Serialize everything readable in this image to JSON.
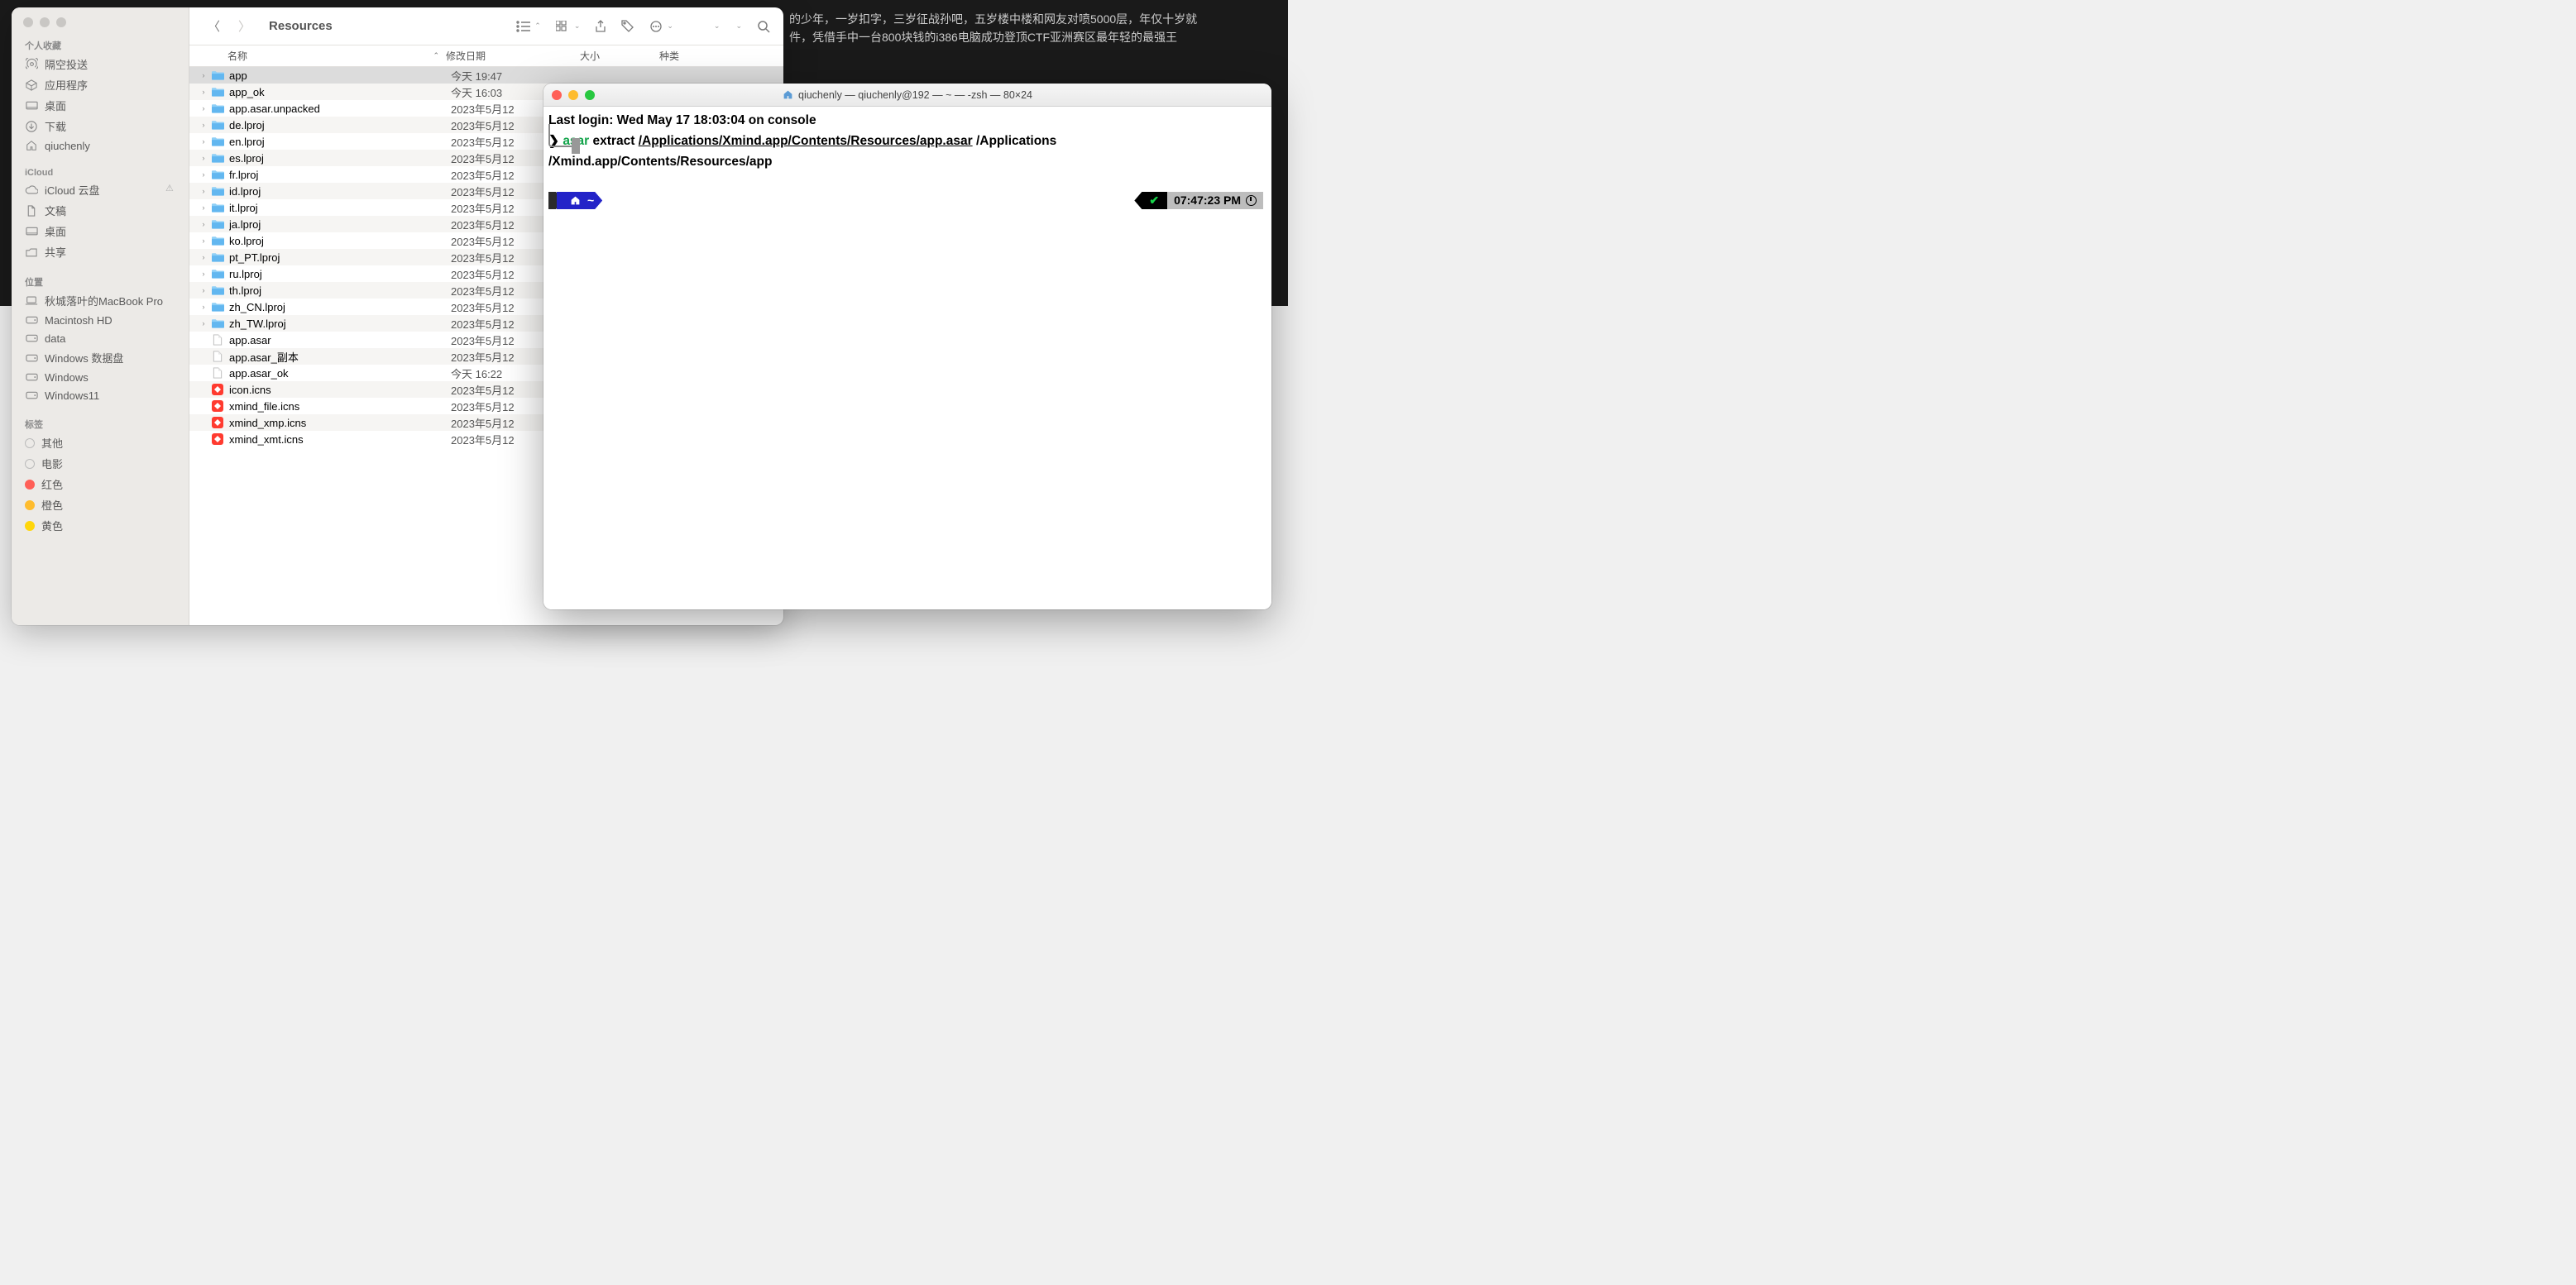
{
  "background_text": {
    "line1": "的少年，一岁扣字，三岁征战孙吧，五岁楼中楼和网友对喷5000层，年仅十岁就",
    "line2": "件，凭借手中一台800块钱的i386电脑成功登顶CTF亚洲赛区最年轻的最强王"
  },
  "finder": {
    "title": "Resources",
    "sidebar": {
      "favorites_label": "个人收藏",
      "favorites": [
        {
          "icon": "airdrop",
          "label": "隔空投送"
        },
        {
          "icon": "apps",
          "label": "应用程序"
        },
        {
          "icon": "desktop",
          "label": "桌面"
        },
        {
          "icon": "downloads",
          "label": "下载"
        },
        {
          "icon": "home",
          "label": "qiuchenly"
        }
      ],
      "icloud_label": "iCloud",
      "icloud": [
        {
          "icon": "cloud",
          "label": "iCloud 云盘",
          "warn": true
        },
        {
          "icon": "doc",
          "label": "文稿"
        },
        {
          "icon": "desktop",
          "label": "桌面"
        },
        {
          "icon": "share",
          "label": "共享"
        }
      ],
      "locations_label": "位置",
      "locations": [
        {
          "icon": "laptop",
          "label": "秋城落叶的MacBook Pro"
        },
        {
          "icon": "disk",
          "label": "Macintosh HD"
        },
        {
          "icon": "disk",
          "label": "data"
        },
        {
          "icon": "disk",
          "label": "Windows 数据盘"
        },
        {
          "icon": "disk",
          "label": "Windows"
        },
        {
          "icon": "disk",
          "label": "Windows11"
        }
      ],
      "tags_label": "标签",
      "tags": [
        {
          "color": "",
          "label": "其他"
        },
        {
          "color": "",
          "label": "电影"
        },
        {
          "color": "red",
          "label": "红色"
        },
        {
          "color": "orange",
          "label": "橙色"
        },
        {
          "color": "yellow",
          "label": "黄色"
        }
      ]
    },
    "columns": {
      "name": "名称",
      "date": "修改日期",
      "size": "大小",
      "kind": "种类"
    },
    "rows": [
      {
        "type": "folder",
        "name": "app",
        "date": "今天 19:47",
        "selected": true,
        "expandable": true
      },
      {
        "type": "folder",
        "name": "app_ok",
        "date": "今天 16:03",
        "expandable": true
      },
      {
        "type": "folder",
        "name": "app.asar.unpacked",
        "date": "2023年5月12",
        "expandable": true
      },
      {
        "type": "folder",
        "name": "de.lproj",
        "date": "2023年5月12",
        "expandable": true
      },
      {
        "type": "folder",
        "name": "en.lproj",
        "date": "2023年5月12",
        "expandable": true
      },
      {
        "type": "folder",
        "name": "es.lproj",
        "date": "2023年5月12",
        "expandable": true
      },
      {
        "type": "folder",
        "name": "fr.lproj",
        "date": "2023年5月12",
        "expandable": true
      },
      {
        "type": "folder",
        "name": "id.lproj",
        "date": "2023年5月12",
        "expandable": true
      },
      {
        "type": "folder",
        "name": "it.lproj",
        "date": "2023年5月12",
        "expandable": true
      },
      {
        "type": "folder",
        "name": "ja.lproj",
        "date": "2023年5月12",
        "expandable": true
      },
      {
        "type": "folder",
        "name": "ko.lproj",
        "date": "2023年5月12",
        "expandable": true
      },
      {
        "type": "folder",
        "name": "pt_PT.lproj",
        "date": "2023年5月12",
        "expandable": true
      },
      {
        "type": "folder",
        "name": "ru.lproj",
        "date": "2023年5月12",
        "expandable": true
      },
      {
        "type": "folder",
        "name": "th.lproj",
        "date": "2023年5月12",
        "expandable": true
      },
      {
        "type": "folder",
        "name": "zh_CN.lproj",
        "date": "2023年5月12",
        "expandable": true
      },
      {
        "type": "folder",
        "name": "zh_TW.lproj",
        "date": "2023年5月12",
        "expandable": true
      },
      {
        "type": "file",
        "name": "app.asar",
        "date": "2023年5月12"
      },
      {
        "type": "file",
        "name": "app.asar_副本",
        "date": "2023年5月12"
      },
      {
        "type": "file",
        "name": "app.asar_ok",
        "date": "今天 16:22"
      },
      {
        "type": "icns",
        "name": "icon.icns",
        "date": "2023年5月12"
      },
      {
        "type": "icns",
        "name": "xmind_file.icns",
        "date": "2023年5月12"
      },
      {
        "type": "icns",
        "name": "xmind_xmp.icns",
        "date": "2023年5月12"
      },
      {
        "type": "icns",
        "name": "xmind_xmt.icns",
        "date": "2023年5月12"
      }
    ]
  },
  "terminal": {
    "title": "qiuchenly — qiuchenly@192 — ~ — -zsh — 80×24",
    "last_login": "Last login: Wed May 17 18:03:04 on console",
    "prompt_char": "❯",
    "cmd_asar": "asar",
    "cmd_extract": "extract",
    "path1": "/Applications/Xmind.app/Contents/Resources/app.asar",
    "path2_a": "/Applications",
    "path2_b": "/Xmind.app/Contents/Resources/app",
    "prompt_tilde": "~",
    "status_check": "✔",
    "status_time": "07:47:23 PM"
  }
}
